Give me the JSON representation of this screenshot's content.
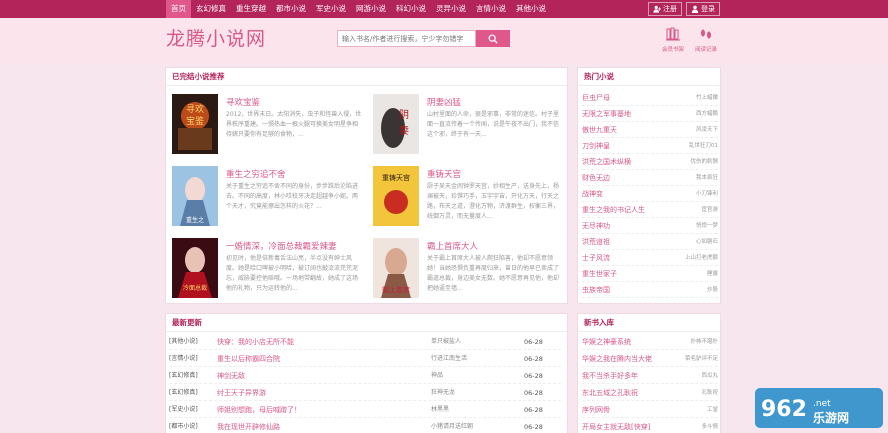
{
  "nav": {
    "items": [
      "首页",
      "玄幻修真",
      "重生穿越",
      "都市小说",
      "军史小说",
      "网游小说",
      "科幻小说",
      "灵异小说",
      "言情小说",
      "其他小说"
    ],
    "active_index": 0,
    "register": "注册",
    "login": "登录"
  },
  "header": {
    "logo": "龙腾小说网",
    "search_placeholder": "输入书名/作者进行搜索，宁少字勿错字",
    "bookshelf": "会员书架",
    "history": "阅读记录"
  },
  "recommend": {
    "title": "已完结小说推荐",
    "books": [
      {
        "title": "寻欢宝鉴",
        "desc": "2012，世界末日。太阳消失，虫子和怪兽入侵，世界秩序重建。一颁热血一根火腿可换美女明星争相待嫁只要你有足够的食物，..."
      },
      {
        "title": "阴妻凶猛",
        "desc": "山村里面的人命，很是邪事，非常的迷信。村子里面一直流传着一个传闻，说是午夜不出门，我不信这个邪，终于有一天..."
      },
      {
        "title": "重生之穷追不舍",
        "desc": "关于重生之穷追不舍不同的身份，步步踩后沦陷进去。不同的高度，林小哎校牙决走超越争小妮。两个天才，究竟能擦出怎样的火花？..."
      },
      {
        "title": "重铸天宫",
        "desc": "厨子吴天金闹钟罗天宫，妙相生产，送身先上，杨澜被天，珍馔巧手，玉宇宇宙，开化万天，行天之路，布天之道，澄化万物，济渡群生，权衡三界，统御万灵，而无量度人..."
      },
      {
        "title": "一婚情深，冷面总裁霸爱辣妻",
        "desc": "初见时，他是倍新毒舌法山亮，半点没有绅士风度。她是哈口啤被小明哈，被订阔也敲流流芫芫泥忘，威胁要控他赔哦。一场地带翻故，她成了这场他的礼物，只为运转他的..."
      },
      {
        "title": "霸上首席大人",
        "desc": "关于霸上首席大人被人爬狂陷害，他却不愿意领她！当她恐惧负重再度归来，曾日的他早已卖成了霸道总裁，身边美女无数。她不愿意再见他，他却把她逼至墙..."
      }
    ]
  },
  "hot": {
    "title": "热门小说",
    "items": [
      {
        "name": "巨虫尸母",
        "author": "竹上蜡嫩"
      },
      {
        "name": "无限之军事基地",
        "author": "西方蜡鹏"
      },
      {
        "name": "傲世九重天",
        "author": "风凌天下"
      },
      {
        "name": "刀剑神皇",
        "author": "乱世狂刀01"
      },
      {
        "name": "洪荒之国术纵横",
        "author": "忧伤的刺猬"
      },
      {
        "name": "财色无边",
        "author": "我本疯狂"
      },
      {
        "name": "战神变",
        "author": "小刀锋利"
      },
      {
        "name": "重生之我的书记人生",
        "author": "宦官游"
      },
      {
        "name": "无尽神功",
        "author": "恍惚一梦"
      },
      {
        "name": "洪荒道祖",
        "author": "心如磐石"
      },
      {
        "name": "士子风流",
        "author": "上山打老虎额"
      },
      {
        "name": "重生世家子",
        "author": "睡露"
      },
      {
        "name": "虫族帝国",
        "author": "炒股"
      }
    ]
  },
  "updates": {
    "title": "最新更新",
    "rows": [
      {
        "cat": "[其他小说]",
        "name": "快穿：我的小店无所不能",
        "author": "单只椒盐人",
        "date": "06-28"
      },
      {
        "cat": "[言情小说]",
        "name": "重生以后称霸四合院",
        "author": "行进江南生活",
        "date": "06-28"
      },
      {
        "cat": "[玄幻修真]",
        "name": "神剑无敌",
        "author": "神品",
        "date": "06-28"
      },
      {
        "cat": "[玄幻修真]",
        "name": "纣王天子异界游",
        "author": "狂神无龙",
        "date": "06-28"
      },
      {
        "cat": "[军史小说]",
        "name": "师姐别想跑，母后喊蹭了！",
        "author": "林黑黑",
        "date": "06-28"
      },
      {
        "cat": "[都市小说]",
        "name": "我在现世开辟修仙路",
        "author": "小猪请月送红朝",
        "date": "06-28"
      }
    ]
  },
  "newbooks": {
    "title": "新书入库",
    "items": [
      {
        "name": "华娱之神豪系统",
        "author": "扑帏不堪扑"
      },
      {
        "name": "华娱之我在腾内当大佬",
        "author": "菜毛驴评不足"
      },
      {
        "name": "我不当杀手好多年",
        "author": "西瓜丸"
      },
      {
        "name": "东北五域之孔耿祝",
        "author": "孔耿祝"
      },
      {
        "name": "序列网骨",
        "author": "工堂"
      },
      {
        "name": "开局女主就无敌[快穿]",
        "author": "多斗情"
      }
    ]
  },
  "watermark": {
    "brand": "962",
    "domain": ".net",
    "sub": "乐游网"
  },
  "colors": {
    "brand": "#b3245a",
    "accent": "#e0578c",
    "link": "#d9588a",
    "background": "#f7e6ee"
  }
}
